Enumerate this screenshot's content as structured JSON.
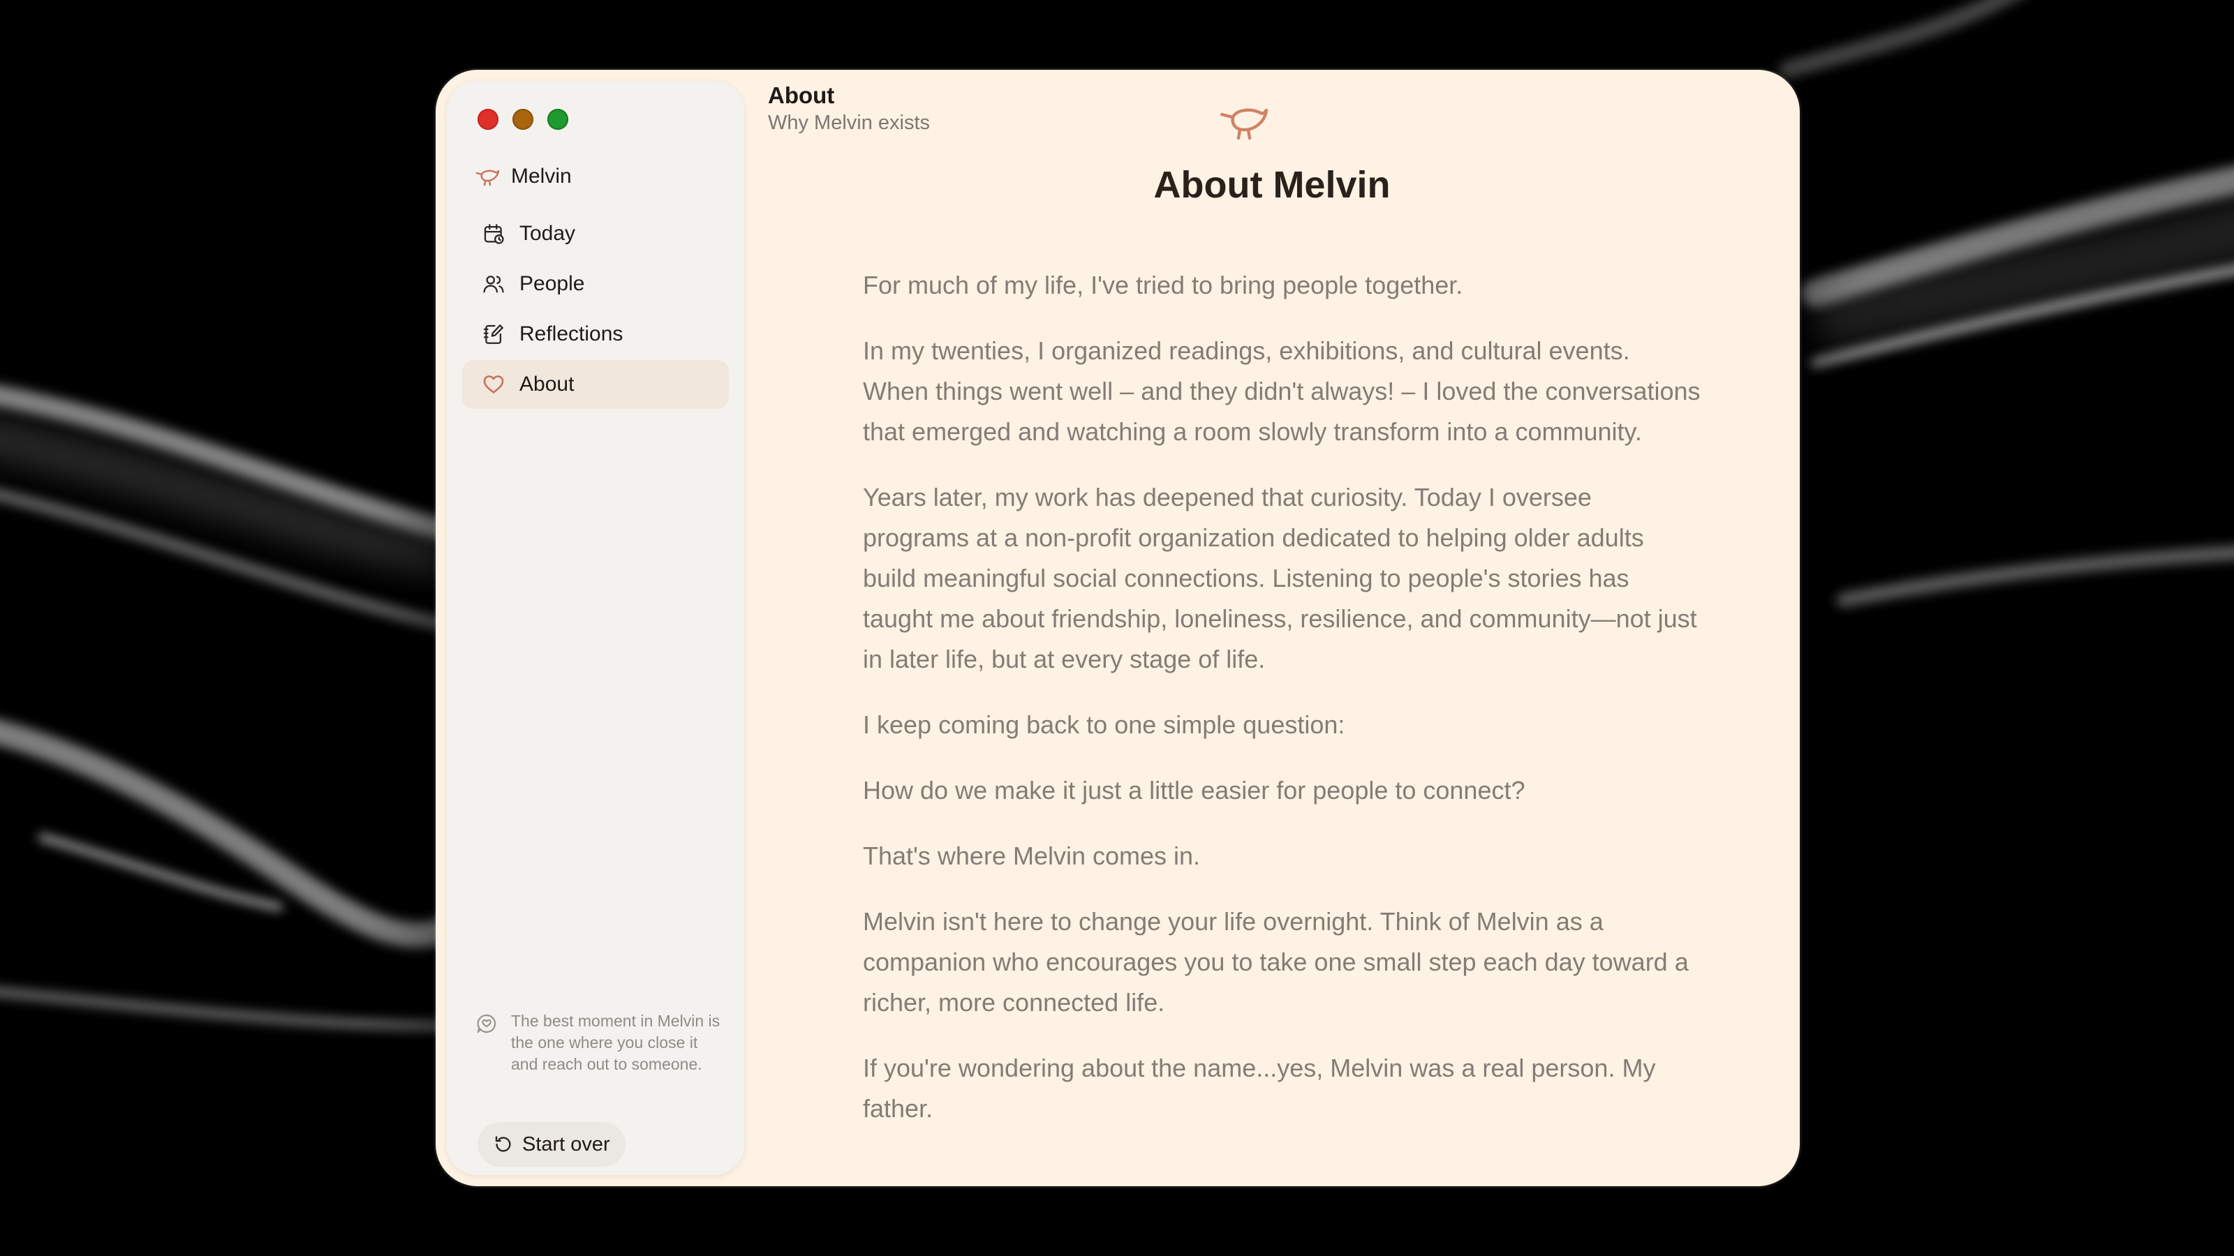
{
  "app": {
    "name": "Melvin"
  },
  "header": {
    "title": "About",
    "subtitle": "Why Melvin exists"
  },
  "sidebar": {
    "items": [
      {
        "label": "Today",
        "icon": "calendar-icon",
        "active": false
      },
      {
        "label": "People",
        "icon": "people-icon",
        "active": false
      },
      {
        "label": "Reflections",
        "icon": "journal-edit-icon",
        "active": false
      },
      {
        "label": "About",
        "icon": "heart-icon",
        "active": true
      }
    ],
    "tip": "The best moment in Melvin is the one where you close it and reach out to someone.",
    "start_over_label": "Start over"
  },
  "main": {
    "title": "About Melvin",
    "paragraphs": [
      "For much of my life, I've tried to bring people together.",
      "In my twenties, I organized readings, exhibitions, and cultural events. When things went well – and they didn't always! – I loved the conversations that emerged and watching a room slowly transform into a community.",
      "Years later, my work has deepened that curiosity. Today I oversee programs at a non-profit organization dedicated to helping older adults build meaningful social connections. Listening to people's stories has taught me about friendship, loneliness, resilience, and community—not just in later life, but at every stage of life.",
      "I keep coming back to one simple question:",
      "How do we make it just a little easier for people to connect?",
      "That's where Melvin comes in.",
      "Melvin isn't here to change your life overnight. Think of Melvin as a companion who encourages you to take one small step each day toward a richer, more connected life.",
      "If you're wondering about the name...yes, Melvin was a real person. My father."
    ]
  },
  "colors": {
    "accent": "#c8705a",
    "window_bg": "#fdf2e3",
    "sidebar_bg": "#f4f2ef",
    "active_item_bg": "#f1e7dd",
    "body_text": "#847c74"
  }
}
